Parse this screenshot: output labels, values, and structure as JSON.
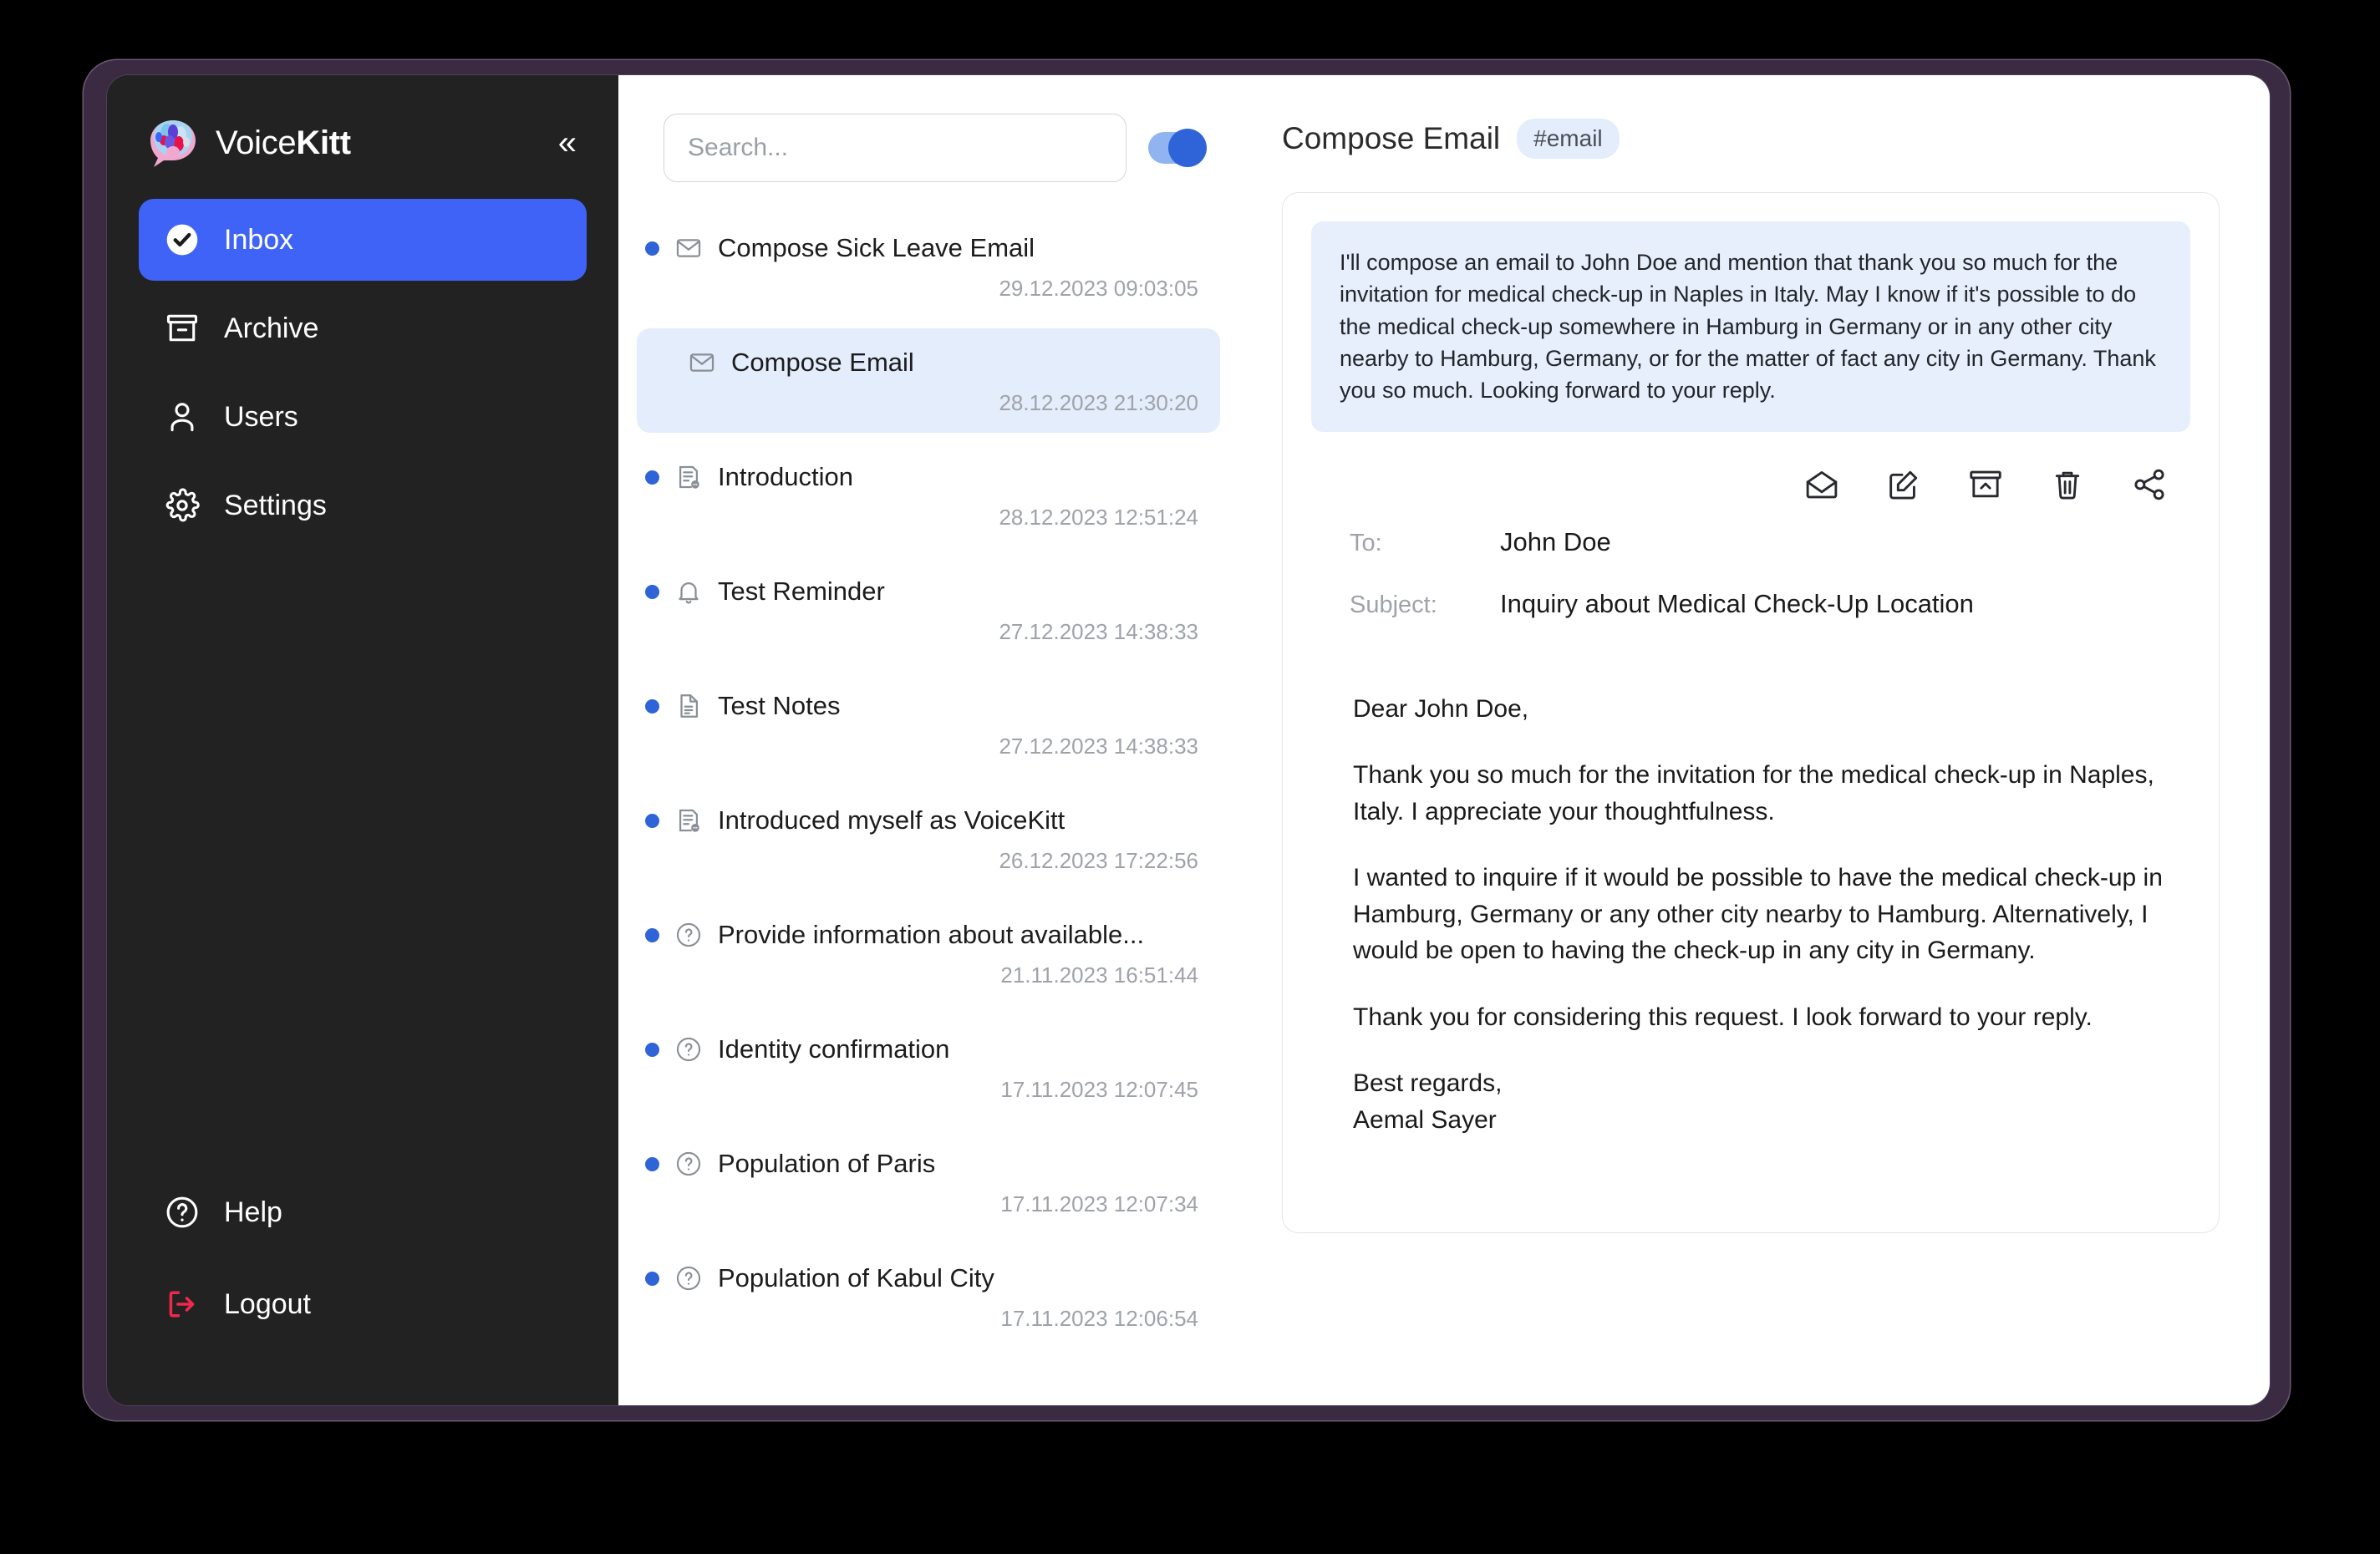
{
  "app": {
    "brand_prefix": "Voice",
    "brand_suffix": "Kitt",
    "collapse_icon": "chevrons-left-icon"
  },
  "sidebar": {
    "items": [
      {
        "label": "Inbox",
        "icon": "check-circle-icon",
        "active": true
      },
      {
        "label": "Archive",
        "icon": "archive-icon",
        "active": false
      },
      {
        "label": "Users",
        "icon": "user-icon",
        "active": false
      },
      {
        "label": "Settings",
        "icon": "gear-icon",
        "active": false
      }
    ],
    "bottom_items": [
      {
        "label": "Help",
        "icon": "help-circle-icon"
      },
      {
        "label": "Logout",
        "icon": "logout-icon"
      }
    ]
  },
  "search": {
    "value": "",
    "placeholder": "Search..."
  },
  "toggle": {
    "state": "on",
    "color": "#2f63d8"
  },
  "messages": [
    {
      "title": "Compose Sick Leave Email",
      "date": "29.12.2023 09:03:05",
      "icon": "envelope-icon",
      "unread": true,
      "selected": false
    },
    {
      "title": "Compose Email",
      "date": "28.12.2023 21:30:20",
      "icon": "envelope-icon",
      "unread": false,
      "selected": true
    },
    {
      "title": "Introduction",
      "date": "28.12.2023 12:51:24",
      "icon": "document-chat-icon",
      "unread": true,
      "selected": false
    },
    {
      "title": "Test Reminder",
      "date": "27.12.2023 14:38:33",
      "icon": "bell-icon",
      "unread": true,
      "selected": false
    },
    {
      "title": "Test Notes",
      "date": "27.12.2023 14:38:33",
      "icon": "file-text-icon",
      "unread": true,
      "selected": false
    },
    {
      "title": "Introduced myself as VoiceKitt",
      "date": "26.12.2023 17:22:56",
      "icon": "document-chat-icon",
      "unread": true,
      "selected": false
    },
    {
      "title": "Provide information about available...",
      "date": "21.11.2023 16:51:44",
      "icon": "question-circle-icon",
      "unread": true,
      "selected": false
    },
    {
      "title": "Identity confirmation",
      "date": "17.11.2023 12:07:45",
      "icon": "question-circle-icon",
      "unread": true,
      "selected": false
    },
    {
      "title": "Population of Paris",
      "date": "17.11.2023 12:07:34",
      "icon": "question-circle-icon",
      "unread": true,
      "selected": false
    },
    {
      "title": "Population of Kabul City",
      "date": "17.11.2023 12:06:54",
      "icon": "question-circle-icon",
      "unread": true,
      "selected": false
    }
  ],
  "detail": {
    "title": "Compose Email",
    "tag": "#email",
    "prompt": "I'll compose an email to John Doe and mention that thank you so much for the invitation for medical check-up in Naples in Italy. May I know if it's possible to do the medical check-up somewhere in Hamburg in Germany or in any other city nearby to Hamburg, Germany, or for the matter of fact any city in Germany. Thank you so much. Looking forward to your reply.",
    "actions": [
      {
        "name": "mark-read",
        "icon": "open-envelope-icon"
      },
      {
        "name": "edit",
        "icon": "pencil-square-icon"
      },
      {
        "name": "archive",
        "icon": "archive-up-icon"
      },
      {
        "name": "delete",
        "icon": "trash-icon"
      },
      {
        "name": "share",
        "icon": "share-icon"
      }
    ],
    "fields": [
      {
        "label": "To:",
        "value": "John Doe"
      },
      {
        "label": "Subject:",
        "value": "Inquiry about Medical Check-Up Location"
      }
    ],
    "body": {
      "greeting": "Dear John Doe,",
      "para1": "Thank you so much for the invitation for the medical check-up in Naples, Italy. I appreciate your thoughtfulness.",
      "para2": "I wanted to inquire if it would be possible to have the medical check-up in Hamburg, Germany or any other city nearby to Hamburg. Alternatively, I would be open to having the check-up in any city in Germany.",
      "para3": "Thank you for considering this request. I look forward to your reply.",
      "closing": "Best regards,",
      "signature": "Aemal Sayer"
    }
  },
  "colors": {
    "accent": "#3f63f6",
    "dot": "#2f63d8",
    "selected_bg": "#e3edfb",
    "logout": "#f2274c",
    "sidebar_bg": "#222222",
    "frame": "#3a2b42"
  }
}
